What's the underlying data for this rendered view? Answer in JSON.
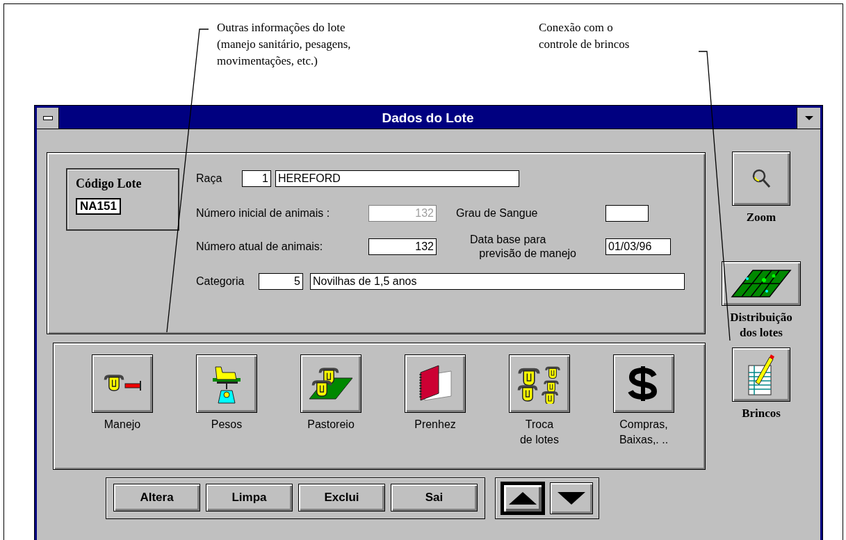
{
  "annotations": [
    {
      "lines": [
        "Outras informações do lote",
        "(manejo sanitário, pesagens,",
        "movimentações, etc.)"
      ]
    },
    {
      "lines": [
        "Conexão com o",
        "controle de brincos"
      ]
    }
  ],
  "window": {
    "title": "Dados do Lote"
  },
  "lot_code": {
    "label": "Código Lote",
    "value": "NA151"
  },
  "breed": {
    "label": "Raça",
    "code": "1",
    "name": "HEREFORD"
  },
  "initial_animals": {
    "label": "Número inicial de animais :",
    "value": "132",
    "disabled": true
  },
  "blood_grade": {
    "label": "Grau de Sangue"
  },
  "current_animals": {
    "label": "Número atual de animais:",
    "value": "132",
    "disabled": false
  },
  "base_date": {
    "label_lines": [
      "Data base para",
      "previsão de manejo"
    ],
    "value": "01/03/96"
  },
  "category": {
    "label": "Categoria",
    "code": "5",
    "name": "Novilhas de 1,5 anos"
  },
  "tool_buttons": [
    {
      "kind": "manejo",
      "label_lines": [
        "Manejo"
      ]
    },
    {
      "kind": "pesos",
      "label_lines": [
        "Pesos"
      ]
    },
    {
      "kind": "pastoreio",
      "label_lines": [
        "Pastoreio"
      ]
    },
    {
      "kind": "prenhez",
      "label_lines": [
        "Prenhez"
      ]
    },
    {
      "kind": "troca",
      "label_lines": [
        "Troca",
        "de lotes"
      ]
    },
    {
      "kind": "compras",
      "label_lines": [
        "Compras,",
        "Baixas,. .."
      ]
    }
  ],
  "side_buttons": [
    {
      "kind": "zoom",
      "label_lines": [
        "Zoom"
      ]
    },
    {
      "kind": "distribution",
      "label_lines": [
        "Distribuição",
        "dos lotes"
      ]
    },
    {
      "kind": "tags",
      "label_lines": [
        "Brincos"
      ]
    }
  ],
  "action_buttons": [
    "Altera",
    "Limpa",
    "Exclui",
    "Sai"
  ],
  "nav_buttons": [
    {
      "kind": "up",
      "focused": true
    },
    {
      "kind": "down",
      "focused": false
    }
  ]
}
